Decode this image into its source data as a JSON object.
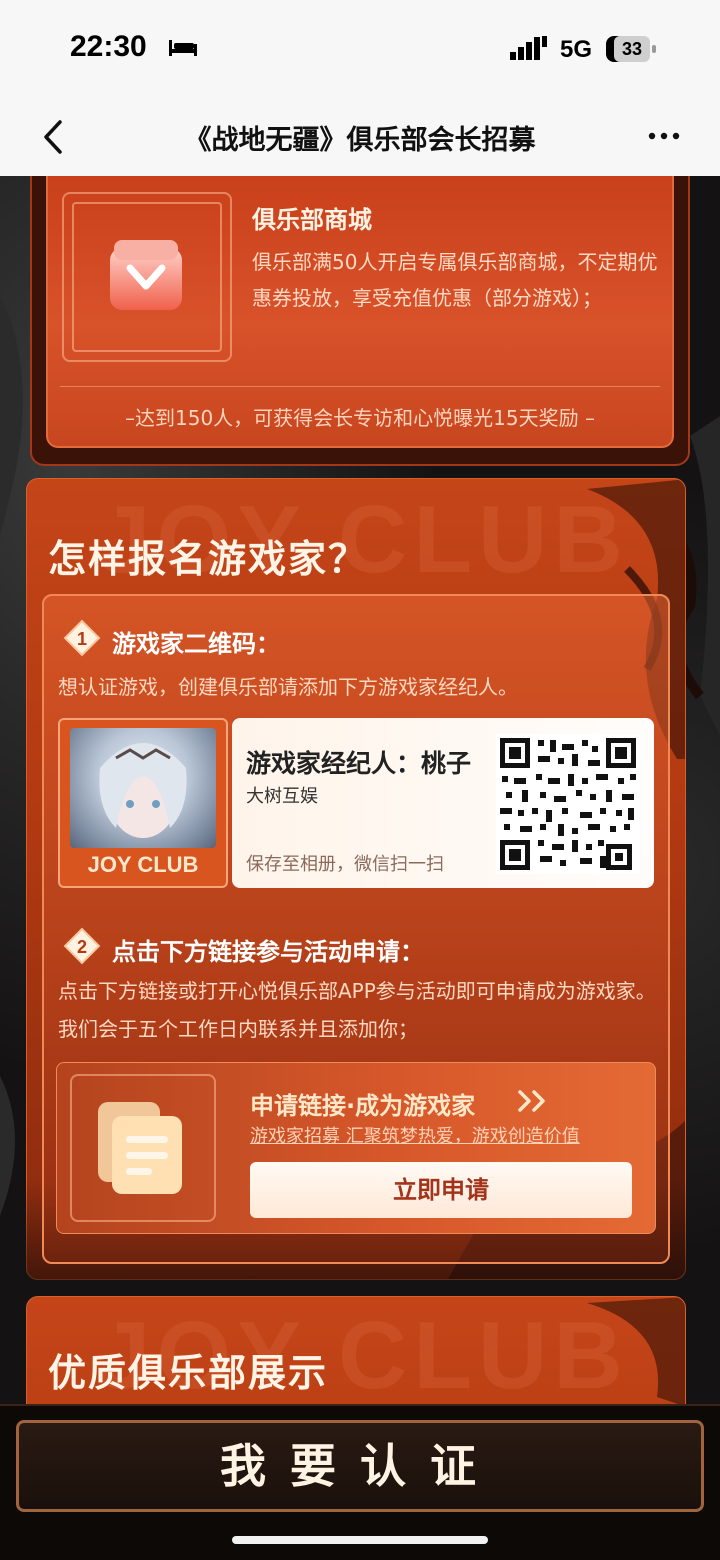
{
  "status_bar": {
    "time": "22:30",
    "network": "5G",
    "battery": "33"
  },
  "nav": {
    "title": "《战地无疆》俱乐部会长招募"
  },
  "mall_section": {
    "title": "俱乐部商城",
    "description": "俱乐部满50人开启专属俱乐部商城，不定期优惠券投放，享受充值优惠（部分游戏）；",
    "reward": "–达到150人，可获得会长专访和心悦曝光15天奖励 –"
  },
  "signup_section": {
    "title": "怎样报名游戏家？",
    "watermark": "JOY CLUB",
    "step1": {
      "number": "1",
      "heading": "游戏家二维码：",
      "description": "想认证游戏，创建俱乐部请添加下方游戏家经纪人。"
    },
    "agent": {
      "photo_label": "JOY CLUB",
      "name": "游戏家经纪人：桃子",
      "company": "大树互娱",
      "hint": "保存至相册，微信扫一扫"
    },
    "step2": {
      "number": "2",
      "heading": "点击下方链接参与活动申请：",
      "description": "点击下方链接或打开心悦俱乐部APP参与活动即可申请成为游戏家。我们会于五个工作日内联系并且添加你；"
    },
    "apply": {
      "title": "申请链接·成为游戏家",
      "subtitle": "游戏家招募 汇聚筑梦热爱，游戏创造价值",
      "button": "立即申请"
    }
  },
  "showcase_section": {
    "title": "优质俱乐部展示",
    "watermark": "JOY CLUB"
  },
  "certify_button": "我要认证",
  "colors": {
    "accent": "#c44518",
    "button_text": "#a3331a"
  }
}
